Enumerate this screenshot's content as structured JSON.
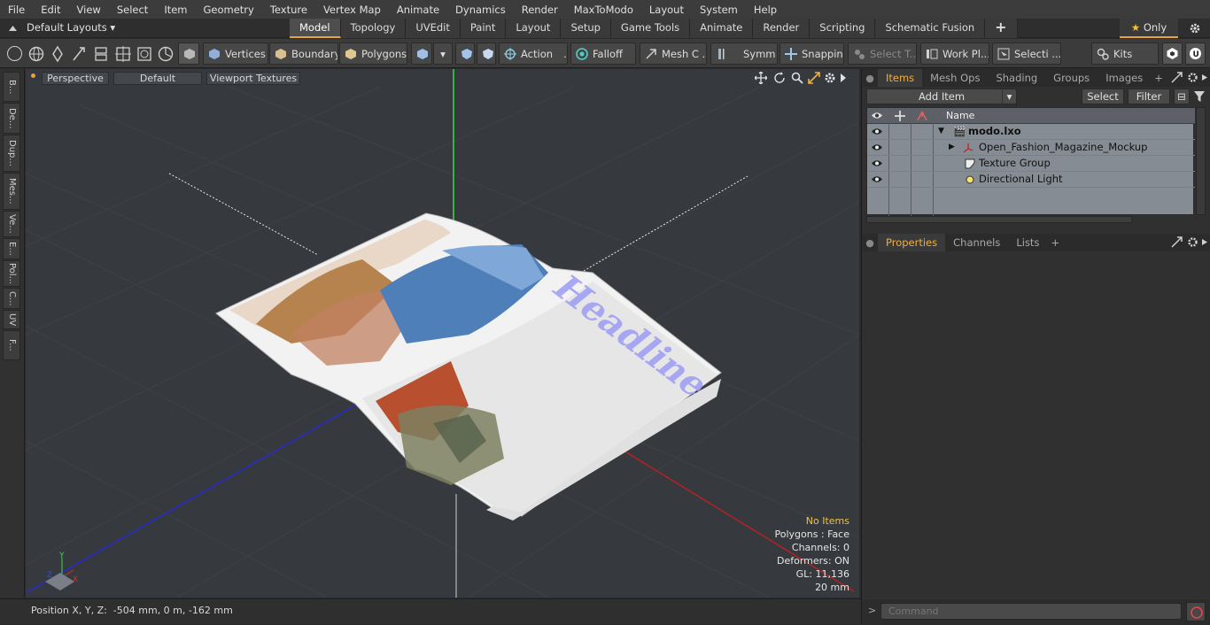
{
  "menu": [
    "File",
    "Edit",
    "View",
    "Select",
    "Item",
    "Geometry",
    "Texture",
    "Vertex Map",
    "Animate",
    "Dynamics",
    "Render",
    "MaxToModo",
    "Layout",
    "System",
    "Help"
  ],
  "layout": {
    "preset": "Default Layouts"
  },
  "layout_tabs": [
    {
      "label": "Model",
      "active": true
    },
    {
      "label": "Topology"
    },
    {
      "label": "UVEdit"
    },
    {
      "label": "Paint"
    },
    {
      "label": "Layout"
    },
    {
      "label": "Setup"
    },
    {
      "label": "Game Tools"
    },
    {
      "label": "Animate"
    },
    {
      "label": "Render"
    },
    {
      "label": "Scripting"
    },
    {
      "label": "Schematic Fusion"
    }
  ],
  "only_label": "Only",
  "toolbar": {
    "vertices": "Vertices",
    "boundary": "Boundary",
    "polygons": "Polygons",
    "action": "Action",
    "falloff": "Falloff",
    "mesh": "Mesh C ...",
    "symm": "Symm ...",
    "snapping": "Snapping",
    "select_t": "Select T...",
    "workpl": "Work Pl...",
    "selecti": "Selecti ...",
    "kits": "Kits"
  },
  "left_tabs": [
    "B...",
    "De...",
    "Dup...",
    "Mes...",
    "Ve...",
    "E...",
    "Pol...",
    "C...",
    "UV",
    "F..."
  ],
  "viewport": {
    "view": "Perspective",
    "shading": "Default",
    "textures": "Viewport Textures",
    "page_text": "Headline",
    "stats": {
      "items": "No Items",
      "polygons": "Polygons : Face",
      "channels": "Channels: 0",
      "deformers": "Deformers: ON",
      "gl": "GL: 11,136",
      "scale": "20 mm"
    },
    "axis": {
      "y": "Y",
      "x": "X",
      "z": "Z"
    }
  },
  "status": {
    "position": "Position X, Y, Z:  -504 mm, 0 m, -162 mm"
  },
  "items_panel": {
    "tabs": [
      {
        "label": "Items",
        "active": true
      },
      {
        "label": "Mesh Ops"
      },
      {
        "label": "Shading"
      },
      {
        "label": "Groups"
      },
      {
        "label": "Images"
      }
    ],
    "add_item": "Add Item",
    "select": "Select",
    "filter": "Filter",
    "col_name": "Name",
    "rows": [
      {
        "name": "modo.lxo",
        "bold": true
      },
      {
        "name": "Open_Fashion_Magazine_Mockup"
      },
      {
        "name": "Texture Group"
      },
      {
        "name": "Directional Light"
      }
    ]
  },
  "props_panel": {
    "tabs": [
      {
        "label": "Properties",
        "active": true
      },
      {
        "label": "Channels"
      },
      {
        "label": "Lists"
      }
    ]
  },
  "command": {
    "placeholder": "Command"
  },
  "colors": {
    "accent": "#e8a33a",
    "viewport_bg": "#36393d",
    "list_bg": "#868c93"
  }
}
